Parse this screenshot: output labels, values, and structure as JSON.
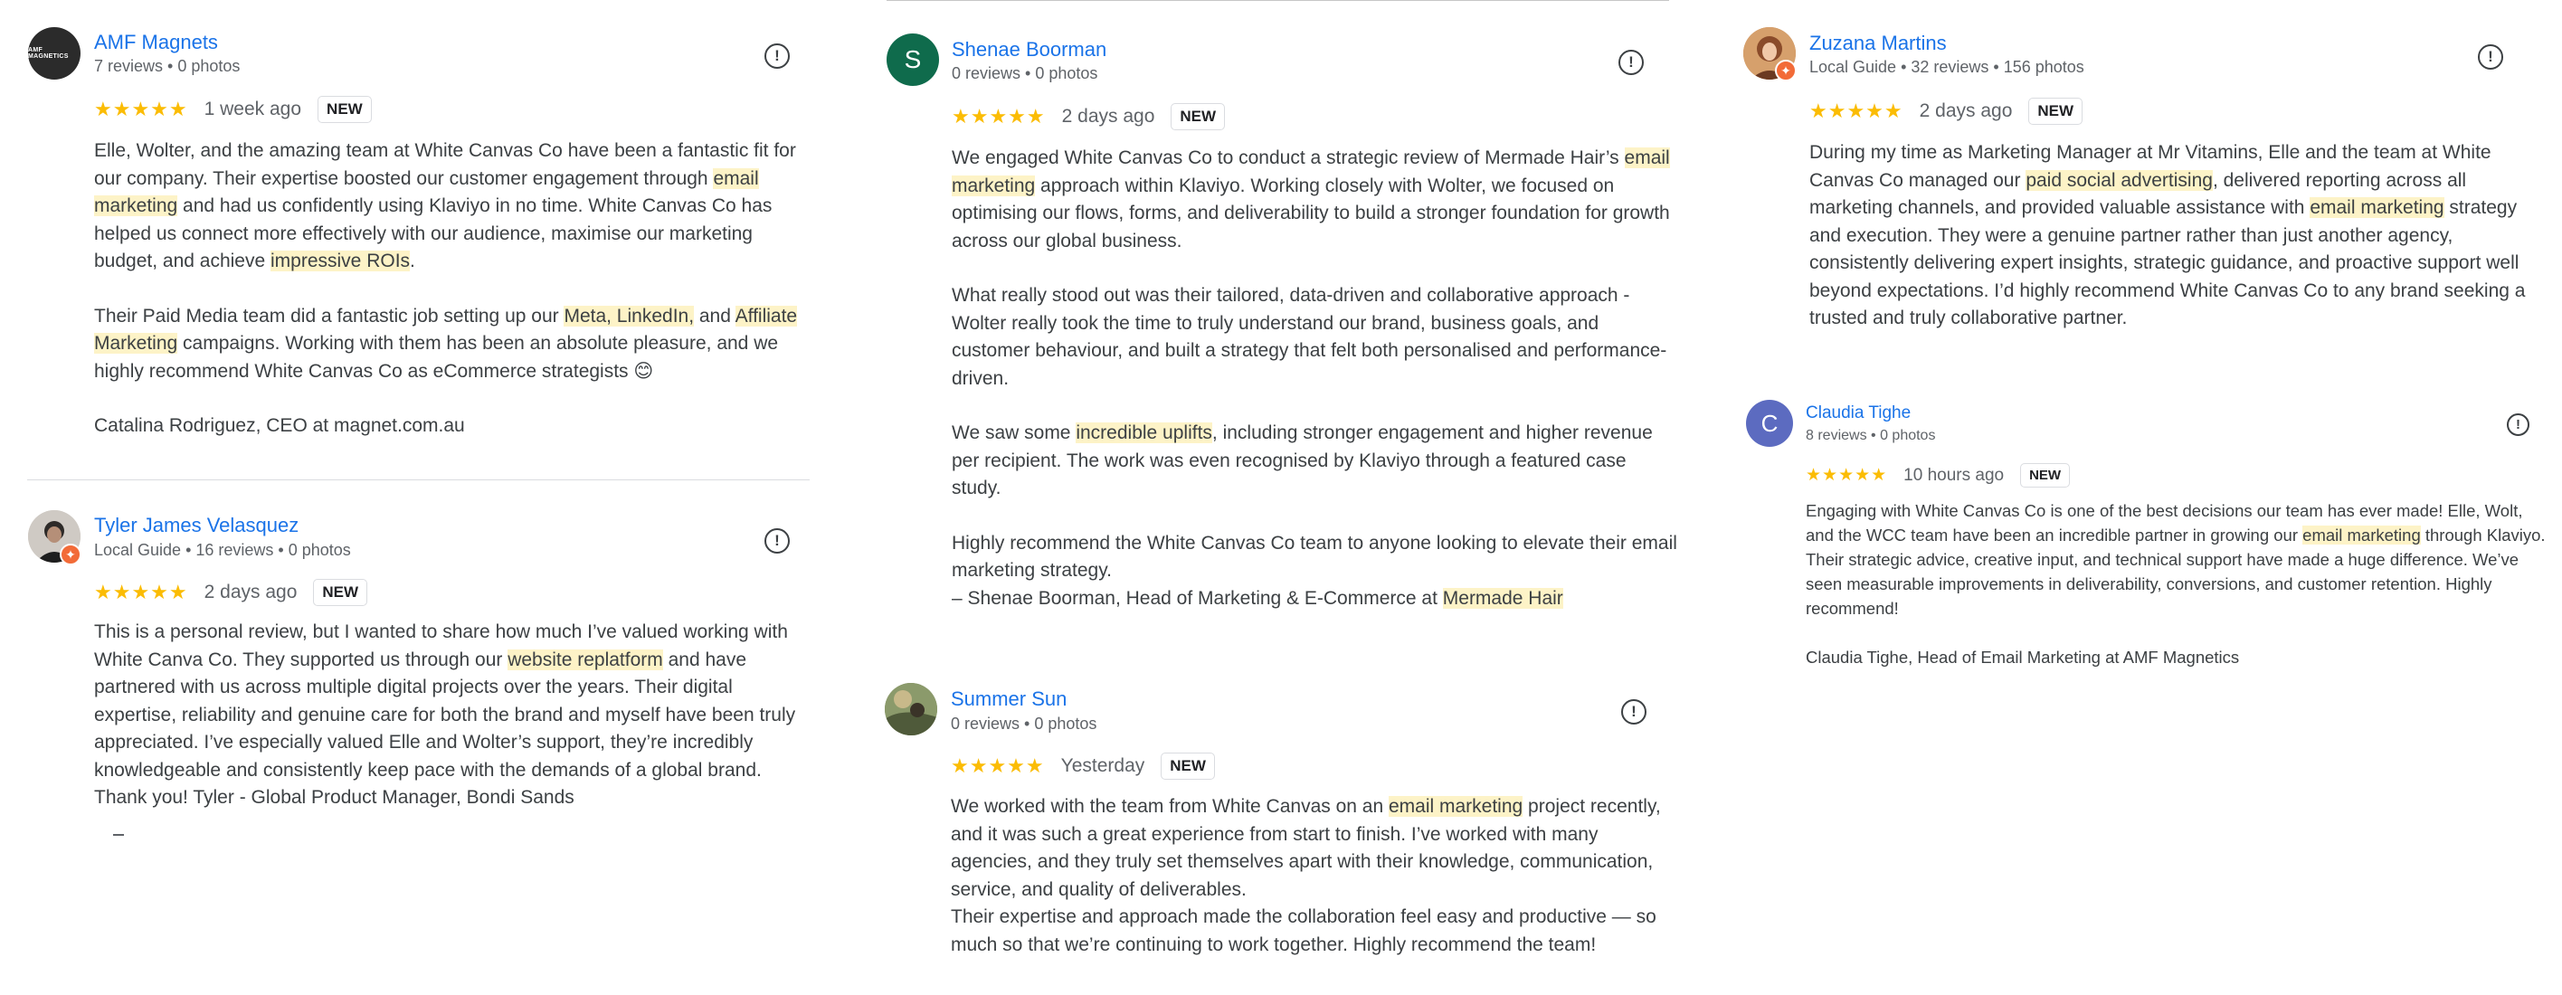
{
  "reviews": {
    "amf": {
      "avatar_text": "AMF MAGNETICS",
      "name": "AMF Magnets",
      "meta": "7 reviews • 0 photos",
      "stars": "★★★★★",
      "time": "1 week ago",
      "badge": "NEW",
      "p1": [
        {
          "t": "Elle, Wolter, and the amazing team at White Canvas Co have been a fantastic fit for our company. Their expertise boosted our customer engagement through ",
          "h": false
        },
        {
          "t": "email marketing",
          "h": true
        },
        {
          "t": " and had us confidently using Klaviyo in no time. White Canvas Co has helped us connect more effectively with our audience, maximise our marketing budget, and achieve ",
          "h": false
        },
        {
          "t": "impressive ROIs",
          "h": true
        },
        {
          "t": ".",
          "h": false
        }
      ],
      "p2": [
        {
          "t": "Their Paid Media team did a fantastic job setting up our ",
          "h": false
        },
        {
          "t": "Meta, LinkedIn,",
          "h": true
        },
        {
          "t": " and ",
          "h": false
        },
        {
          "t": "Affiliate Marketing",
          "h": true
        },
        {
          "t": " campaigns. Working with them has been an absolute pleasure, and we highly recommend White Canvas Co as eCommerce strategists 😊",
          "h": false
        }
      ],
      "p3": [
        {
          "t": "Catalina Rodriguez, CEO at magnet.com.au",
          "h": false
        }
      ]
    },
    "tyler": {
      "name": "Tyler James Velasquez",
      "meta": "Local Guide • 16 reviews • 0 photos",
      "stars": "★★★★★",
      "time": "2 days ago",
      "badge": "NEW",
      "p1": [
        {
          "t": "This is a personal review, but I wanted to share how much I’ve valued working with White Canva Co. They supported us through our ",
          "h": false
        },
        {
          "t": "website replatform",
          "h": true
        },
        {
          "t": " and have partnered with us across multiple digital projects over the years. Their digital expertise, reliability and genuine care for both the brand and myself have been truly appreciated. I’ve especially valued Elle and Wolter’s support, they’re incredibly knowledgeable and consistently keep pace with the demands of a global brand. Thank you! Tyler - Global Product Manager, Bondi Sands",
          "h": false
        }
      ]
    },
    "shenae": {
      "avatar_letter": "S",
      "name": "Shenae Boorman",
      "meta": "0 reviews • 0 photos",
      "stars": "★★★★★",
      "time": "2 days ago",
      "badge": "NEW",
      "p1": [
        {
          "t": "We engaged White Canvas Co to conduct a strategic review of Mermade Hair’s ",
          "h": false
        },
        {
          "t": "email marketing",
          "h": true
        },
        {
          "t": " approach within Klaviyo. Working closely with Wolter, we focused on optimising our flows, forms, and deliverability to build a stronger foundation for growth across our global business.",
          "h": false
        }
      ],
      "p2": [
        {
          "t": "What really stood out was their tailored, data-driven and collaborative approach - Wolter really took the time to truly understand our brand, business goals, and customer behaviour, and built a strategy that felt both personalised and performance-driven.",
          "h": false
        }
      ],
      "p3": [
        {
          "t": "We saw some ",
          "h": false
        },
        {
          "t": "incredible uplifts",
          "h": true
        },
        {
          "t": ", including stronger engagement and higher revenue per recipient. The work was even recognised by Klaviyo through a featured case study.",
          "h": false
        }
      ],
      "p4": [
        {
          "t": "Highly recommend the White Canvas Co team to anyone looking to elevate their email marketing strategy.",
          "h": false
        }
      ],
      "p5": [
        {
          "t": "– Shenae Boorman, Head of Marketing & E-Commerce at ",
          "h": false
        },
        {
          "t": "Mermade Hair",
          "h": true
        }
      ]
    },
    "summer": {
      "name": "Summer Sun",
      "meta": "0 reviews • 0 photos",
      "stars": "★★★★★",
      "time": "Yesterday",
      "badge": "NEW",
      "p1": [
        {
          "t": "We worked with the team from White Canvas on an ",
          "h": false
        },
        {
          "t": "email marketing",
          "h": true
        },
        {
          "t": " project recently, and it was such a great experience from start to finish. I’ve worked with many agencies, and they truly set themselves apart with their knowledge, communication, service, and quality of deliverables.",
          "h": false
        }
      ],
      "p2": [
        {
          "t": "Their expertise and approach made the collaboration feel easy and productive — so much so that we’re continuing to work together. Highly recommend the team!",
          "h": false
        }
      ]
    },
    "zuzana": {
      "name": "Zuzana Martins",
      "meta": "Local Guide • 32 reviews • 156 photos",
      "stars": "★★★★★",
      "time": "2 days ago",
      "badge": "NEW",
      "p1": [
        {
          "t": "During my time as Marketing Manager at Mr Vitamins, Elle and the team at White Canvas Co managed our ",
          "h": false
        },
        {
          "t": "paid social advertising",
          "h": true
        },
        {
          "t": ", delivered reporting across all marketing channels, and provided valuable assistance with ",
          "h": false
        },
        {
          "t": "email marketing",
          "h": true
        },
        {
          "t": " strategy and execution. They were a genuine partner rather than just another agency, consistently delivering expert insights, strategic guidance, and proactive support well beyond expectations. I’d highly recommend White Canvas Co to any brand seeking a trusted and truly collaborative partner.",
          "h": false
        }
      ]
    },
    "claudia": {
      "avatar_letter": "C",
      "name": "Claudia Tighe",
      "meta": "8 reviews • 0 photos",
      "stars": "★★★★★",
      "time": "10 hours ago",
      "badge": "NEW",
      "p1": [
        {
          "t": "Engaging with White Canvas Co is one of the best decisions our team has ever made! Elle, Wolt, and the WCC team have been an incredible partner in growing our ",
          "h": false
        },
        {
          "t": "email marketing",
          "h": true
        },
        {
          "t": " through Klaviyo. Their strategic advice, creative input, and technical support have made a huge difference. We’ve seen measurable improvements in deliverability, conversions, and customer retention. Highly recommend!",
          "h": false
        }
      ],
      "p2": [
        {
          "t": "Claudia Tighe, Head of Email Marketing at AMF Magnetics",
          "h": false
        }
      ]
    }
  },
  "colors": {
    "name_link": "#1a73e8",
    "star": "#fbbc04",
    "highlight": "#fdf3c7",
    "shenae_avatar": "#0f6b4c",
    "claudia_avatar": "#5c6bc0"
  },
  "icons": {
    "flag": "report-flag-icon",
    "local_guide": "local-guide-badge-icon"
  },
  "flag_glyph": "!"
}
